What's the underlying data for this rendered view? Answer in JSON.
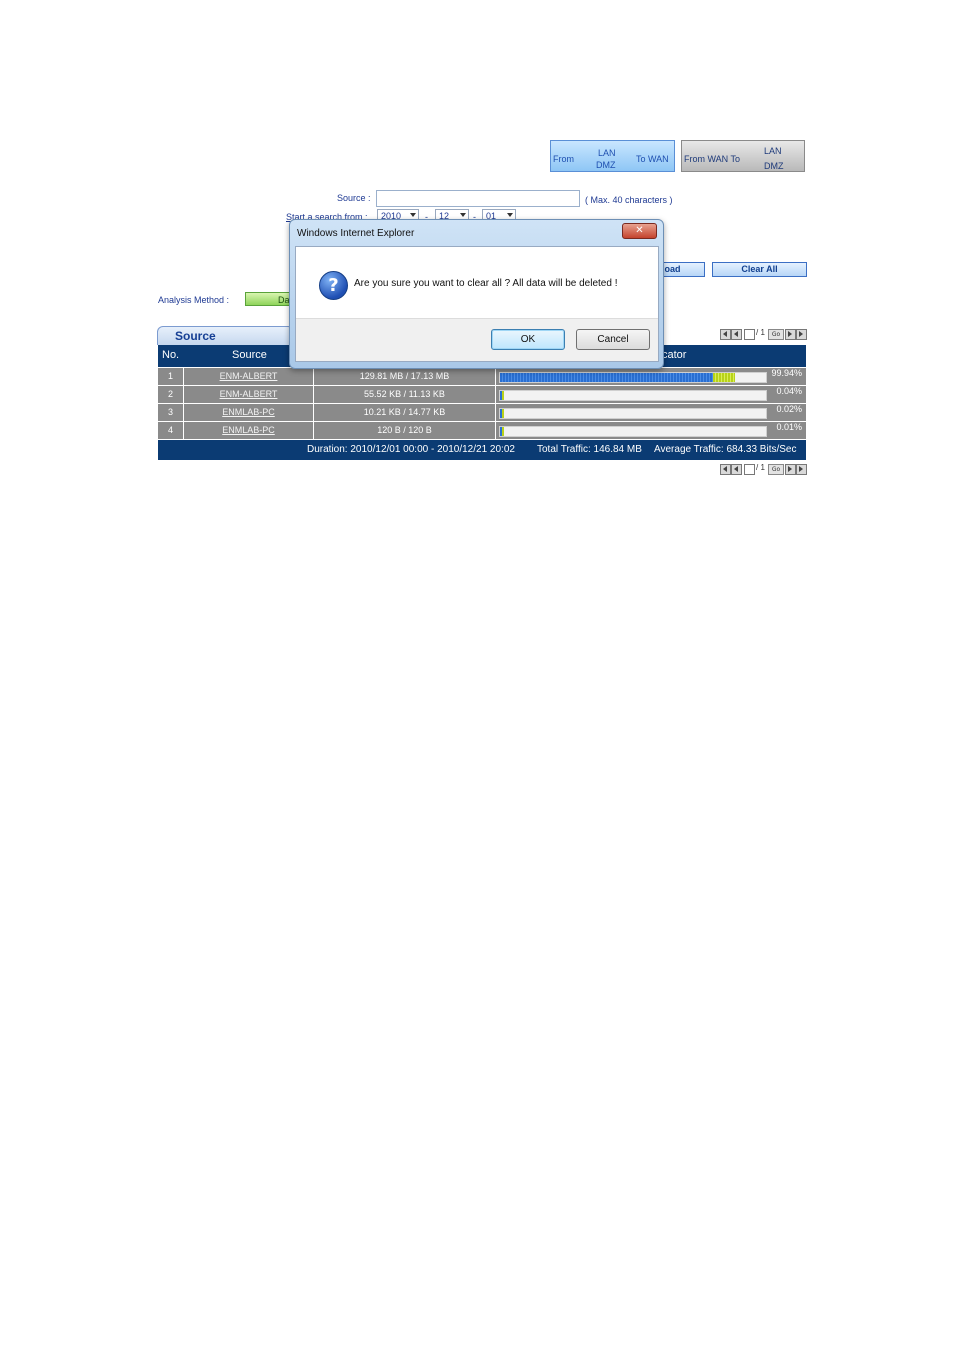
{
  "direction_buttons": {
    "from_lan_dmz_to_wan": {
      "from": "From",
      "lan": "LAN",
      "dmz": "DMZ",
      "to": "To WAN"
    },
    "from_wan_to_lan_dmz": {
      "from_to": "From WAN To",
      "lan": "LAN",
      "dmz": "DMZ"
    }
  },
  "search": {
    "source_label": "Source :",
    "source_value": "",
    "max_hint": "( Max. 40 characters )",
    "start_label": "Start a search from :",
    "year": "2010",
    "month": "12",
    "day": "01",
    "sep": "-"
  },
  "actions": {
    "download_label": "oad",
    "clear_all_label": "Clear All"
  },
  "analysis": {
    "label": "Analysis Method :",
    "value": "Da"
  },
  "table": {
    "tab_label": "Source",
    "headers": {
      "no": "No.",
      "source": "Source",
      "indicator": "cator"
    },
    "rows": [
      {
        "no": "1",
        "source": "ENM-ALBERT",
        "traffic": "129.81 MB / 17.13 MB",
        "bar_label": "",
        "percent_label": "99.94%",
        "percent": 99.94
      },
      {
        "no": "2",
        "source": "ENM-ALBERT",
        "traffic": "55.52 KB / 11.13 KB",
        "bar_label": "",
        "percent_label": "0.04%",
        "percent": 0.04
      },
      {
        "no": "3",
        "source": "ENMLAB-PC",
        "traffic": "10.21 KB / 14.77 KB",
        "bar_label": "",
        "percent_label": "0.02%",
        "percent": 0.02
      },
      {
        "no": "4",
        "source": "ENMLAB-PC",
        "traffic": "120 B / 120 B",
        "bar_label": "",
        "percent_label": "0.01%",
        "percent": 0.01
      }
    ],
    "footer": {
      "duration": "Duration: 2010/12/01 00:00 - 2010/12/21 20:02",
      "total": "Total Traffic: 146.84 MB",
      "average": "Average Traffic: 684.33 Bits/Sec"
    },
    "pager": {
      "page": "",
      "total": "/ 1",
      "go": "Go"
    }
  },
  "dialog": {
    "title": "Windows Internet Explorer",
    "close": "✕",
    "message": "Are you sure you want to clear all ? All data will be deleted !",
    "ok_label": "OK",
    "cancel_label": "Cancel",
    "icon": "question-icon"
  }
}
